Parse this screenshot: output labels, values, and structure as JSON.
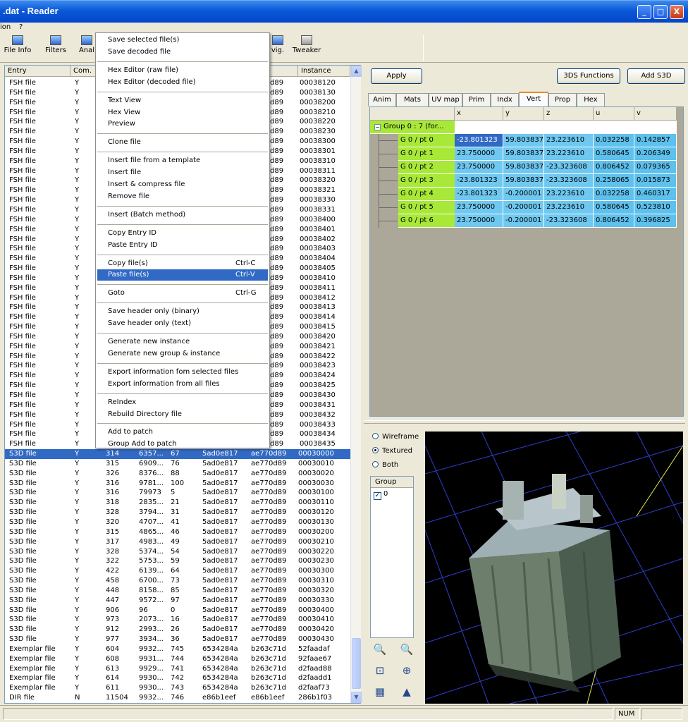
{
  "window": {
    "title": ".dat - Reader",
    "buttons": [
      "_",
      "□",
      "X"
    ]
  },
  "menubar": [
    "ion",
    "?"
  ],
  "toolbar": [
    {
      "label": "File Info",
      "icon": "file-info-icon"
    },
    {
      "label": "Filters",
      "icon": "filters-icon"
    },
    {
      "label": "Anal",
      "icon": "analyze-icon"
    },
    {
      "label": "vig.",
      "icon": "navigator-icon"
    },
    {
      "label": "Tweaker",
      "icon": "tweaker-icon"
    }
  ],
  "list": {
    "headers": [
      "Entry",
      "Com.",
      "",
      "",
      "",
      "",
      "Instance"
    ],
    "rows": [
      [
        "FSH file",
        "Y",
        "",
        "",
        "",
        "d89",
        "00038120"
      ],
      [
        "FSH file",
        "Y",
        "",
        "",
        "",
        "d89",
        "00038130"
      ],
      [
        "FSH file",
        "Y",
        "",
        "",
        "",
        "d89",
        "00038200"
      ],
      [
        "FSH file",
        "Y",
        "",
        "",
        "",
        "d89",
        "00038210"
      ],
      [
        "FSH file",
        "Y",
        "",
        "",
        "",
        "d89",
        "00038220"
      ],
      [
        "FSH file",
        "Y",
        "",
        "",
        "",
        "d89",
        "00038230"
      ],
      [
        "FSH file",
        "Y",
        "",
        "",
        "",
        "d89",
        "00038300"
      ],
      [
        "FSH file",
        "Y",
        "",
        "",
        "",
        "d89",
        "00038301"
      ],
      [
        "FSH file",
        "Y",
        "",
        "",
        "",
        "d89",
        "00038310"
      ],
      [
        "FSH file",
        "Y",
        "",
        "",
        "",
        "d89",
        "00038311"
      ],
      [
        "FSH file",
        "Y",
        "",
        "",
        "",
        "d89",
        "00038320"
      ],
      [
        "FSH file",
        "Y",
        "",
        "",
        "",
        "d89",
        "00038321"
      ],
      [
        "FSH file",
        "Y",
        "",
        "",
        "",
        "d89",
        "00038330"
      ],
      [
        "FSH file",
        "Y",
        "",
        "",
        "",
        "d89",
        "00038331"
      ],
      [
        "FSH file",
        "Y",
        "",
        "",
        "",
        "d89",
        "00038400"
      ],
      [
        "FSH file",
        "Y",
        "",
        "",
        "",
        "d89",
        "00038401"
      ],
      [
        "FSH file",
        "Y",
        "",
        "",
        "",
        "d89",
        "00038402"
      ],
      [
        "FSH file",
        "Y",
        "",
        "",
        "",
        "d89",
        "00038403"
      ],
      [
        "FSH file",
        "Y",
        "",
        "",
        "",
        "d89",
        "00038404"
      ],
      [
        "FSH file",
        "Y",
        "",
        "",
        "",
        "d89",
        "00038405"
      ],
      [
        "FSH file",
        "Y",
        "",
        "",
        "",
        "d89",
        "00038410"
      ],
      [
        "FSH file",
        "Y",
        "",
        "",
        "",
        "d89",
        "00038411"
      ],
      [
        "FSH file",
        "Y",
        "",
        "",
        "",
        "d89",
        "00038412"
      ],
      [
        "FSH file",
        "Y",
        "",
        "",
        "",
        "d89",
        "00038413"
      ],
      [
        "FSH file",
        "Y",
        "",
        "",
        "",
        "d89",
        "00038414"
      ],
      [
        "FSH file",
        "Y",
        "",
        "",
        "",
        "d89",
        "00038415"
      ],
      [
        "FSH file",
        "Y",
        "",
        "",
        "",
        "d89",
        "00038420"
      ],
      [
        "FSH file",
        "Y",
        "",
        "",
        "",
        "d89",
        "00038421"
      ],
      [
        "FSH file",
        "Y",
        "",
        "",
        "",
        "d89",
        "00038422"
      ],
      [
        "FSH file",
        "Y",
        "",
        "",
        "",
        "d89",
        "00038423"
      ],
      [
        "FSH file",
        "Y",
        "",
        "",
        "",
        "d89",
        "00038424"
      ],
      [
        "FSH file",
        "Y",
        "",
        "",
        "",
        "d89",
        "00038425"
      ],
      [
        "FSH file",
        "Y",
        "",
        "",
        "",
        "d89",
        "00038430"
      ],
      [
        "FSH file",
        "Y",
        "",
        "",
        "",
        "d89",
        "00038431"
      ],
      [
        "FSH file",
        "Y",
        "",
        "",
        "",
        "d89",
        "00038432"
      ],
      [
        "FSH file",
        "Y",
        "",
        "",
        "",
        "d89",
        "00038433"
      ],
      [
        "FSH file",
        "Y",
        "",
        "",
        "",
        "d89",
        "00038434"
      ],
      [
        "FSH file",
        "Y",
        "",
        "",
        "",
        "d89",
        "00038435"
      ],
      [
        "S3D file",
        "Y",
        "314",
        "6357...",
        "67",
        "5ad0e817",
        "ae770d89",
        "00030000"
      ],
      [
        "S3D file",
        "Y",
        "315",
        "6909...",
        "76",
        "5ad0e817",
        "ae770d89",
        "00030010"
      ],
      [
        "S3D file",
        "Y",
        "326",
        "8376...",
        "88",
        "5ad0e817",
        "ae770d89",
        "00030020"
      ],
      [
        "S3D file",
        "Y",
        "316",
        "9781...",
        "100",
        "5ad0e817",
        "ae770d89",
        "00030030"
      ],
      [
        "S3D file",
        "Y",
        "316",
        "79973",
        "5",
        "5ad0e817",
        "ae770d89",
        "00030100"
      ],
      [
        "S3D file",
        "Y",
        "318",
        "2835...",
        "21",
        "5ad0e817",
        "ae770d89",
        "00030110"
      ],
      [
        "S3D file",
        "Y",
        "328",
        "3794...",
        "31",
        "5ad0e817",
        "ae770d89",
        "00030120"
      ],
      [
        "S3D file",
        "Y",
        "320",
        "4707...",
        "41",
        "5ad0e817",
        "ae770d89",
        "00030130"
      ],
      [
        "S3D file",
        "Y",
        "315",
        "4865...",
        "46",
        "5ad0e817",
        "ae770d89",
        "00030200"
      ],
      [
        "S3D file",
        "Y",
        "317",
        "4983...",
        "49",
        "5ad0e817",
        "ae770d89",
        "00030210"
      ],
      [
        "S3D file",
        "Y",
        "328",
        "5374...",
        "54",
        "5ad0e817",
        "ae770d89",
        "00030220"
      ],
      [
        "S3D file",
        "Y",
        "322",
        "5753...",
        "59",
        "5ad0e817",
        "ae770d89",
        "00030230"
      ],
      [
        "S3D file",
        "Y",
        "422",
        "6139...",
        "64",
        "5ad0e817",
        "ae770d89",
        "00030300"
      ],
      [
        "S3D file",
        "Y",
        "458",
        "6700...",
        "73",
        "5ad0e817",
        "ae770d89",
        "00030310"
      ],
      [
        "S3D file",
        "Y",
        "448",
        "8158...",
        "85",
        "5ad0e817",
        "ae770d89",
        "00030320"
      ],
      [
        "S3D file",
        "Y",
        "447",
        "9572...",
        "97",
        "5ad0e817",
        "ae770d89",
        "00030330"
      ],
      [
        "S3D file",
        "Y",
        "906",
        "96",
        "0",
        "5ad0e817",
        "ae770d89",
        "00030400"
      ],
      [
        "S3D file",
        "Y",
        "973",
        "2073...",
        "16",
        "5ad0e817",
        "ae770d89",
        "00030410"
      ],
      [
        "S3D file",
        "Y",
        "912",
        "2993...",
        "26",
        "5ad0e817",
        "ae770d89",
        "00030420"
      ],
      [
        "S3D file",
        "Y",
        "977",
        "3934...",
        "36",
        "5ad0e817",
        "ae770d89",
        "00030430"
      ],
      [
        "Exemplar file",
        "Y",
        "604",
        "9932...",
        "745",
        "6534284a",
        "b263c71d",
        "52faadaf"
      ],
      [
        "Exemplar file",
        "Y",
        "608",
        "9931...",
        "744",
        "6534284a",
        "b263c71d",
        "92faae67"
      ],
      [
        "Exemplar file",
        "Y",
        "613",
        "9929...",
        "741",
        "6534284a",
        "b263c71d",
        "d2faad88"
      ],
      [
        "Exemplar file",
        "Y",
        "614",
        "9930...",
        "742",
        "6534284a",
        "b263c71d",
        "d2faadd1"
      ],
      [
        "Exemplar file",
        "Y",
        "611",
        "9930...",
        "743",
        "6534284a",
        "b263c71d",
        "d2faaf73"
      ],
      [
        "DIR file",
        "N",
        "11504",
        "9932...",
        "746",
        "e86b1eef",
        "e86b1eef",
        "286b1f03"
      ]
    ],
    "selected_index": 38
  },
  "context_menu": {
    "items": [
      {
        "label": "Save selected file(s)"
      },
      {
        "label": "Save decoded file"
      },
      {
        "sep": true
      },
      {
        "label": "Hex Editor (raw file)"
      },
      {
        "label": "Hex Editor (decoded file)"
      },
      {
        "sep": true
      },
      {
        "label": "Text View"
      },
      {
        "label": "Hex View"
      },
      {
        "label": "Preview"
      },
      {
        "sep": true
      },
      {
        "label": "Clone file"
      },
      {
        "sep": true
      },
      {
        "label": "Insert file from a template"
      },
      {
        "label": "Insert file"
      },
      {
        "label": "Insert & compress file"
      },
      {
        "label": "Remove file"
      },
      {
        "sep": true
      },
      {
        "label": "Insert (Batch method)"
      },
      {
        "sep": true
      },
      {
        "label": "Copy Entry ID"
      },
      {
        "label": "Paste Entry ID"
      },
      {
        "sep": true
      },
      {
        "label": "Copy file(s)",
        "shortcut": "Ctrl-C"
      },
      {
        "label": "Paste file(s)",
        "shortcut": "Ctrl-V",
        "highlight": true
      },
      {
        "sep": true
      },
      {
        "label": "Goto",
        "shortcut": "Ctrl-G"
      },
      {
        "sep": true
      },
      {
        "label": "Save header only (binary)"
      },
      {
        "label": "Save header only (text)"
      },
      {
        "sep": true
      },
      {
        "label": "Generate new instance"
      },
      {
        "label": "Generate new group & instance"
      },
      {
        "sep": true
      },
      {
        "label": "Export information fom selected files"
      },
      {
        "label": "Export information from all files"
      },
      {
        "sep": true
      },
      {
        "label": "ReIndex"
      },
      {
        "label": "Rebuild Directory file"
      },
      {
        "sep": true
      },
      {
        "label": "Add to patch"
      },
      {
        "label": "Group Add to patch"
      }
    ]
  },
  "right": {
    "buttons": {
      "apply": "Apply",
      "functions": "3DS Functions",
      "add": "Add S3D"
    },
    "tabs": [
      "Anim",
      "Mats",
      "UV map",
      "Prim",
      "Indx",
      "Vert",
      "Prop",
      "Hex"
    ],
    "active_tab": 5,
    "grid": {
      "headers": [
        "x",
        "y",
        "z",
        "u",
        "v"
      ],
      "group_label": "Group 0 : 7 (for...",
      "rows": [
        {
          "name": "G 0 / pt 0",
          "vals": [
            "-23.801323",
            "59.803837",
            "23.223610",
            "0.032258",
            "0.142857"
          ]
        },
        {
          "name": "G 0 / pt 1",
          "vals": [
            "23.750000",
            "59.803837",
            "23.223610",
            "0.580645",
            "0.206349"
          ]
        },
        {
          "name": "G 0 / pt 2",
          "vals": [
            "23.750000",
            "59.803837",
            "-23.323608",
            "0.806452",
            "0.079365"
          ]
        },
        {
          "name": "G 0 / pt 3",
          "vals": [
            "-23.801323",
            "59.803837",
            "-23.323608",
            "0.258065",
            "0.015873"
          ]
        },
        {
          "name": "G 0 / pt 4",
          "vals": [
            "-23.801323",
            "-0.200001",
            "23.223610",
            "0.032258",
            "0.460317"
          ]
        },
        {
          "name": "G 0 / pt 5",
          "vals": [
            "23.750000",
            "-0.200001",
            "23.223610",
            "0.580645",
            "0.523810"
          ]
        },
        {
          "name": "G 0 / pt 6",
          "vals": [
            "23.750000",
            "-0.200001",
            "-23.323608",
            "0.806452",
            "0.396825"
          ]
        }
      ]
    },
    "render_modes": [
      "Wireframe",
      "Textured",
      "Both"
    ],
    "render_selected": 1,
    "group_header": "Group",
    "group_items": [
      "0"
    ]
  },
  "status": {
    "num": "NUM"
  },
  "colors": {
    "selection": "#316ac5",
    "node": "#a8e838",
    "cell": "#6fc8f0"
  }
}
